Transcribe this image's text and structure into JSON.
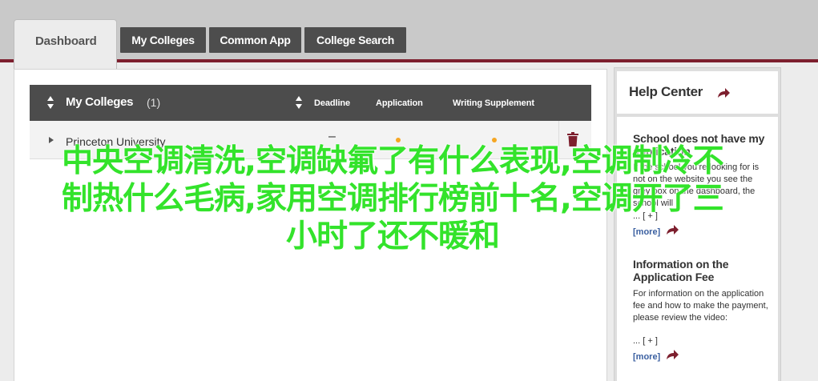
{
  "tabs": {
    "active": "Dashboard",
    "items": [
      "My Colleges",
      "Common App",
      "College Search"
    ]
  },
  "colleges_table": {
    "title": "My Colleges",
    "count": "(1)",
    "columns": {
      "deadline": "Deadline",
      "application": "Application",
      "writing_supplement": "Writing Supplement"
    },
    "rows": [
      {
        "name": "Princeton University",
        "deadline": "–"
      }
    ]
  },
  "help_center": {
    "title": "Help Center",
    "articles": [
      {
        "title": "School does not have my application",
        "text": "If the school you’re looking for is not on the website you see the grey box on the dashboard, the school will",
        "expand": "... [ + ]",
        "more": "[more]"
      },
      {
        "title": "Information on the Application Fee",
        "text": "For information on the application fee and how to make the payment, please review the video:",
        "expand": "... [ + ]",
        "more": "[more]"
      }
    ]
  },
  "overlay": {
    "line1": "中央空调清洗,空调缺氟了有什么表现,空调制冷不",
    "line2": "制热什么毛病,家用空调排行榜前十名,空调开了三",
    "line3": "小时了还不暖和"
  },
  "colors": {
    "accent": "#7d1f2e",
    "tab_bg": "#4d4d4d",
    "status_dot": "#f5a623",
    "link": "#3a5fa0",
    "overlay_text": "#33e32b"
  }
}
